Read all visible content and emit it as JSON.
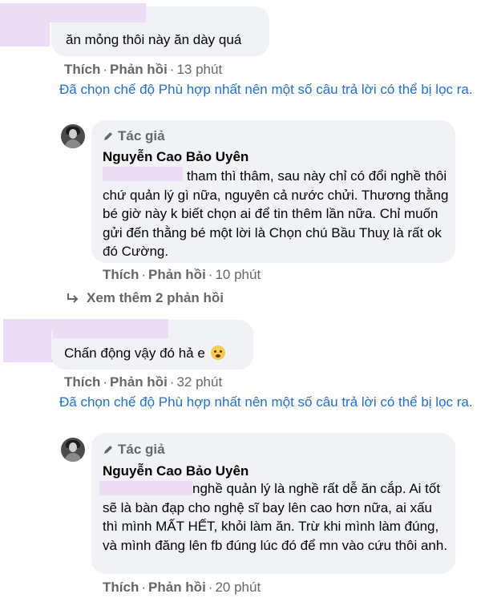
{
  "comment1": {
    "text": "ăn mỏng thôi này ăn dày quá",
    "like": "Thích",
    "reply": "Phản hồi",
    "dot": "·",
    "time": "13 phút",
    "notice": "Đã chọn chế độ Phù hợp nhất nên một số câu trả lời có thể bị lọc ra."
  },
  "reply1": {
    "badge": "Tác giả",
    "author": "Nguyễn Cao Bảo Uyên",
    "text": "tham thì thâm, sau này chỉ có đổi nghề thôi chứ quản lý gì nữa, nguyên cả nước chửi. Thương thằng bé giờ này k biết chọn ai để tin thêm lần nữa. Chỉ muốn gửi đến thằng bé một lời là Chọn chú Bầu Thuỵ là rất ok đó Cường.",
    "like": "Thích",
    "reply": "Phản hồi",
    "dot": "·",
    "time": "10 phút"
  },
  "more_replies": "Xem thêm 2 phản hồi",
  "comment2": {
    "text": "Chấn động vậy đó hả e",
    "emoji": "astonished-face-emoji",
    "like": "Thích",
    "reply": "Phản hồi",
    "dot": "·",
    "time": "32 phút",
    "notice": "Đã chọn chế độ Phù hợp nhất nên một số câu trả lời có thể bị lọc ra."
  },
  "reply2": {
    "badge": "Tác giả",
    "author": "Nguyễn Cao Bảo Uyên",
    "text": "nghề quản lý là nghề rất dễ ăn cắp. Ai tốt sẽ là bàn đạp cho nghệ sĩ bay lên cao hơn nữa, ai xấu thì mình MẤT HẾT, khỏi làm ăn. Trừ khi mình làm đúng, và mình đăng lên fb đúng lúc đó để mn vào cứu thôi anh.",
    "like": "Thích",
    "reply": "Phản hồi",
    "dot": "·",
    "time": "20 phút"
  },
  "colors": {
    "bubble": "#f0f2f5",
    "link_blue": "#216fdb",
    "secondary_text": "#65676b",
    "redaction": "#ecdcf6"
  },
  "icons": [
    "pencil-icon",
    "reply-arrow-icon",
    "avatar"
  ]
}
